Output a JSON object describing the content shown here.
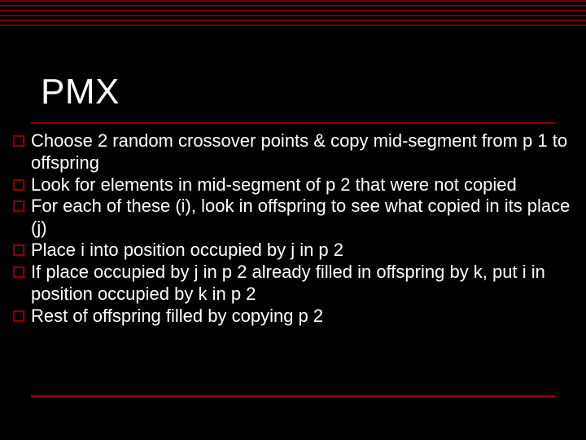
{
  "slide": {
    "title": "PMX",
    "bullets": [
      "Choose 2 random crossover points & copy mid-segment from p 1 to offspring",
      "Look for elements in mid-segment of p 2 that were not copied",
      "For each of these (i), look in offspring to see what copied in its place (j)",
      "Place i into position occupied by j in p 2",
      "If place occupied by j in p 2 already filled in offspring by k, put i in position occupied by k in p 2",
      "Rest of offspring filled by copying p 2"
    ]
  },
  "colors": {
    "background": "#000000",
    "accent": "#8a0000",
    "text": "#ffffff"
  }
}
